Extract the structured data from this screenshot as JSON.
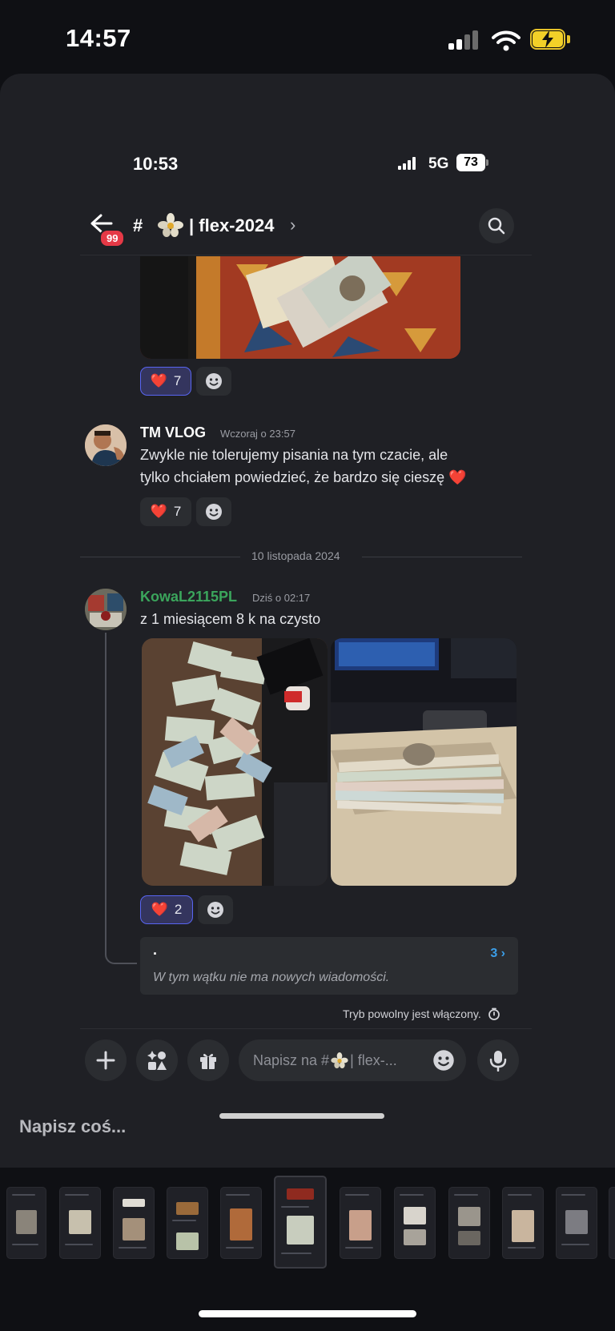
{
  "status_bar": {
    "time": "14:57"
  },
  "inner_status_bar": {
    "time": "10:53",
    "network": "5G",
    "battery": "73"
  },
  "header": {
    "unread_badge": "99",
    "channel_prefix": "#",
    "channel_name": "| flex-2024",
    "chevron": "›"
  },
  "messages": [
    {
      "id": "top-image-message",
      "reaction": {
        "emoji": "❤️",
        "count": "7"
      }
    },
    {
      "id": "tm-vlog",
      "username": "TM VLOG",
      "timestamp": "Wczoraj o 23:57",
      "text_line1": "Zwykle nie tolerujemy pisania na tym czacie, ale",
      "text_line2": "tylko chciałem powiedzieć, że bardzo się cieszę",
      "text_emoji": "❤️",
      "reaction": {
        "emoji": "❤️",
        "count": "7"
      }
    },
    {
      "id": "kowal",
      "username": "KowaL2115PL",
      "username_color": "#3ba55c",
      "timestamp": "Dziś o 02:17",
      "text": "z 1 miesiącem 8 k na czysto",
      "reaction": {
        "emoji": "❤️",
        "count": "2"
      }
    }
  ],
  "date_divider": "10 listopada 2024",
  "thread": {
    "title": ".",
    "count": "3 ›",
    "status": "W tym wątku nie ma nowych wiadomości."
  },
  "slow_mode": "Tryb powolny jest włączony.",
  "composer": {
    "placeholder": "Napisz na #",
    "placeholder_tail": " | flex-..."
  },
  "outer_input": {
    "placeholder": "Napisz coś..."
  },
  "colors": {
    "background": "#0f1014",
    "sheet": "#1f2025",
    "accent": "#5865f2",
    "badge": "#e53946",
    "thread_link": "#3b9ee8"
  },
  "icons": [
    "back-arrow-icon",
    "search-icon",
    "plus-icon",
    "apps-icon",
    "gift-icon",
    "emoji-icon",
    "microphone-icon",
    "clock-icon"
  ]
}
